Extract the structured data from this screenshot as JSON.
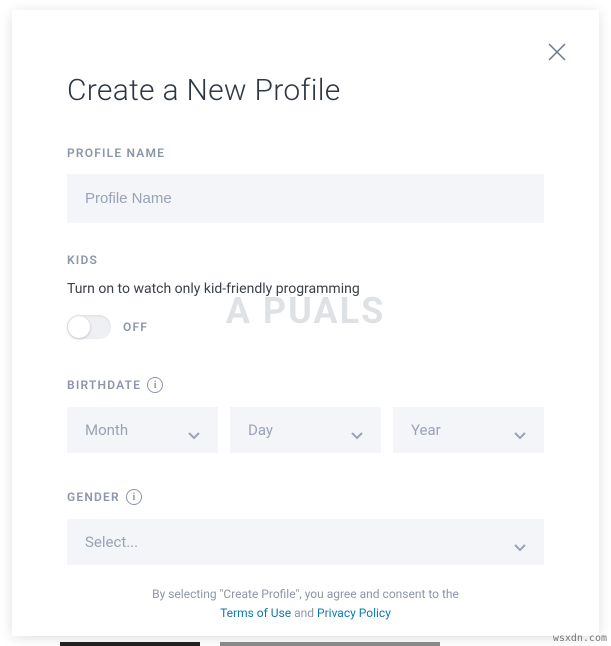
{
  "title": "Create a New Profile",
  "profile": {
    "section_label": "PROFILE NAME",
    "placeholder": "Profile Name"
  },
  "kids": {
    "section_label": "KIDS",
    "description": "Turn on to watch only kid-friendly programming",
    "toggle_state": "OFF"
  },
  "birthdate": {
    "section_label": "BIRTHDATE",
    "month": "Month",
    "day": "Day",
    "year": "Year"
  },
  "gender": {
    "section_label": "GENDER",
    "selected": "Select..."
  },
  "consent": {
    "prefix": "By selecting \"Create Profile\", you agree and consent to the",
    "terms": "Terms of Use",
    "and": " and ",
    "privacy": "Privacy Policy"
  },
  "watermark": "A  PUALS",
  "source": "wsxdn.com"
}
